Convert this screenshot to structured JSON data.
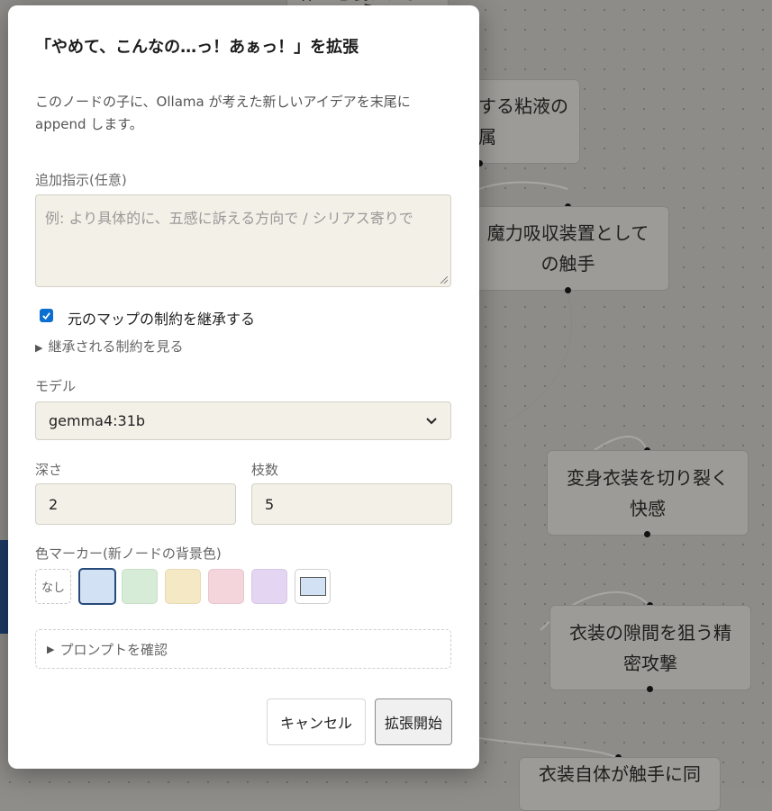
{
  "background": {
    "nodes": [
      {
        "label": "作…を襲われながら",
        "partial": true
      },
      {
        "label": "する粘液の\n属"
      },
      {
        "label": "魔力吸収装置として\nの触手"
      },
      {
        "label": "変身衣装を切り裂く\n快感"
      },
      {
        "label": "衣装の隙間を狙う精\n密攻撃"
      },
      {
        "label": "衣装自体が触手に同"
      }
    ]
  },
  "modal": {
    "title": "「やめて、こんなの…っ！あぁっ！」を拡張",
    "description": "このノードの子に、Ollama が考えた新しいアイデアを末尾に append します。",
    "instruction": {
      "label": "追加指示(任意)",
      "placeholder": "例: より具体的に、五感に訴える方向で / シリアス寄りで",
      "value": ""
    },
    "inherit": {
      "checked": true,
      "label": "元のマップの制約を継承する"
    },
    "show_constraints": "継承される制約を見る",
    "model": {
      "label": "モデル",
      "selected": "gemma4:31b"
    },
    "depth": {
      "label": "深さ",
      "value": "2"
    },
    "branches": {
      "label": "枝数",
      "value": "5"
    },
    "color_marker": {
      "label": "色マーカー(新ノードの背景色)",
      "none_label": "なし",
      "swatches": [
        "#d2e1f3",
        "#d6ecd6",
        "#f4e9c4",
        "#f5d5dc",
        "#e4d6f3"
      ],
      "selected": "#d2e1f3"
    },
    "prompt_check": "プロンプトを確認",
    "cancel_label": "キャンセル",
    "start_label": "拡張開始"
  }
}
